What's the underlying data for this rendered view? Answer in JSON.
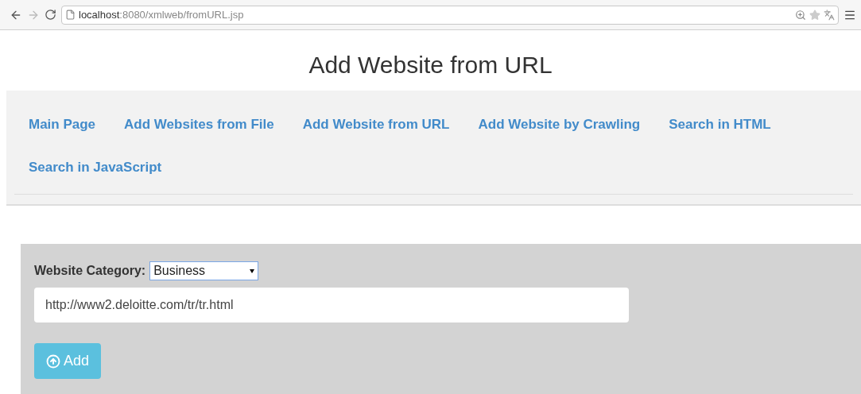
{
  "browser": {
    "url_host": "localhost",
    "url_path": ":8080/xmlweb/fromURL.jsp"
  },
  "page_title": "Add Website from URL",
  "nav": {
    "items": [
      {
        "label": "Main Page"
      },
      {
        "label": "Add Websites from File"
      },
      {
        "label": "Add Website from URL"
      },
      {
        "label": "Add Website by Crawling"
      },
      {
        "label": "Search in HTML"
      },
      {
        "label": "Search in JavaScript"
      }
    ]
  },
  "form": {
    "category_label": "Website Category:",
    "category_value": "Business",
    "url_value": "http://www2.deloitte.com/tr/tr.html",
    "button": "Add"
  }
}
